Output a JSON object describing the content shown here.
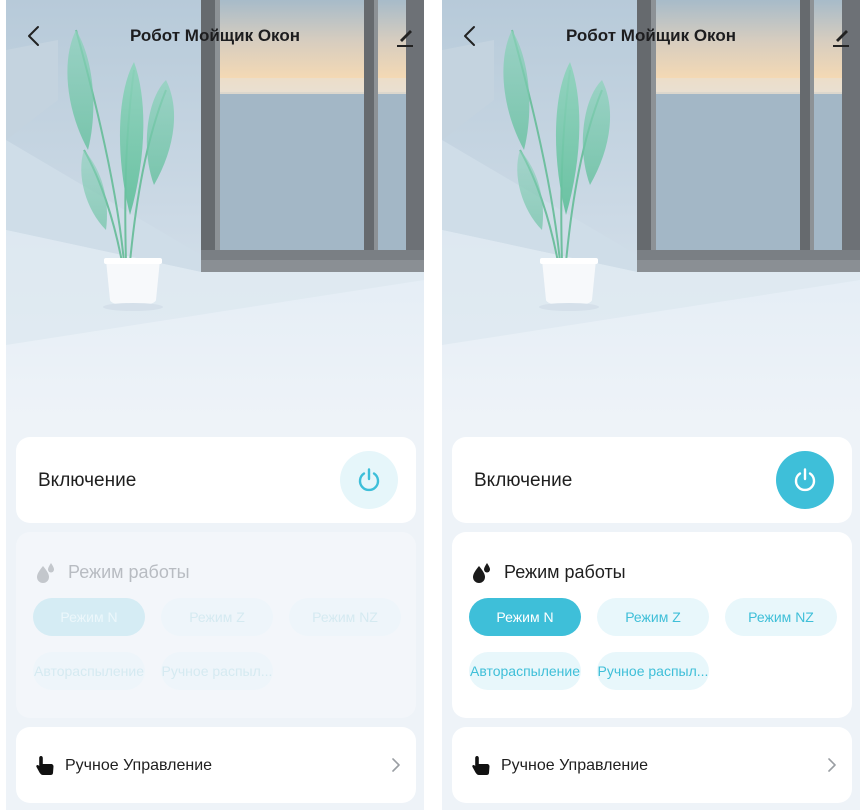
{
  "screens": [
    {
      "state": "off",
      "header": {
        "title": "Робот Мойщик Окон",
        "back_icon": "chevron-left-icon",
        "edit_icon": "pencil-icon"
      },
      "power": {
        "label": "Включение",
        "icon": "power-icon",
        "on": false,
        "button_color": "#e6f6fa",
        "icon_color": "#3ebfd9"
      },
      "mode": {
        "title": "Режим работы",
        "icon": "water-drops-icon",
        "enabled": false,
        "options": [
          "Режим N",
          "Режим Z",
          "Режим NZ",
          "Автораспыление",
          "Ручное распыл..."
        ],
        "selected": "Режим N"
      },
      "manual": {
        "label": "Ручное Управление",
        "icon": "hand-pointer-icon"
      }
    },
    {
      "state": "on",
      "header": {
        "title": "Робот Мойщик Окон",
        "back_icon": "chevron-left-icon",
        "edit_icon": "pencil-icon"
      },
      "power": {
        "label": "Включение",
        "icon": "power-icon",
        "on": true,
        "button_color": "#3ebfd9",
        "icon_color": "#ffffff"
      },
      "mode": {
        "title": "Режим работы",
        "icon": "water-drops-icon",
        "enabled": true,
        "options": [
          "Режим N",
          "Режим Z",
          "Режим NZ",
          "Автораспыление",
          "Ручное распыл..."
        ],
        "selected": "Режим N"
      },
      "manual": {
        "label": "Ручное Управление",
        "icon": "hand-pointer-icon"
      }
    }
  ],
  "colors": {
    "accent": "#3ebfd9",
    "chip_bg": "#e8f7fb",
    "background": "#eef3f8"
  }
}
